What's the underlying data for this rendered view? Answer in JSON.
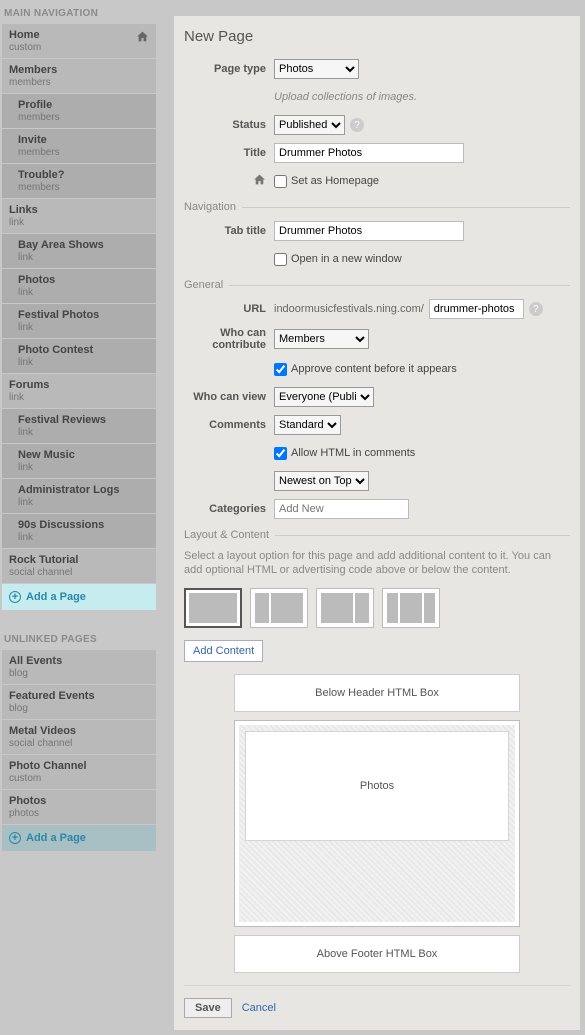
{
  "sidebar": {
    "main_heading": "MAIN NAVIGATION",
    "unlinked_heading": "UNLINKED PAGES",
    "add_page": "Add a Page",
    "main": [
      {
        "title": "Home",
        "sub": "custom",
        "home_icon": true
      },
      {
        "title": "Members",
        "sub": "members"
      },
      {
        "title": "Profile",
        "sub": "members",
        "indent": true
      },
      {
        "title": "Invite",
        "sub": "members",
        "indent": true
      },
      {
        "title": "Trouble?",
        "sub": "members",
        "indent": true
      },
      {
        "title": "Links",
        "sub": "link"
      },
      {
        "title": "Bay Area Shows",
        "sub": "link",
        "indent": true
      },
      {
        "title": "Photos",
        "sub": "link",
        "indent": true
      },
      {
        "title": "Festival Photos",
        "sub": "link",
        "indent": true
      },
      {
        "title": "Photo Contest",
        "sub": "link",
        "indent": true
      },
      {
        "title": "Forums",
        "sub": "link"
      },
      {
        "title": "Festival Reviews",
        "sub": "link",
        "indent": true
      },
      {
        "title": "New Music",
        "sub": "link",
        "indent": true
      },
      {
        "title": "Administrator Logs",
        "sub": "link",
        "indent": true
      },
      {
        "title": "90s Discussions",
        "sub": "link",
        "indent": true
      },
      {
        "title": "Rock Tutorial",
        "sub": "social channel"
      }
    ],
    "unlinked": [
      {
        "title": "All Events",
        "sub": "blog"
      },
      {
        "title": "Featured Events",
        "sub": "blog"
      },
      {
        "title": "Metal Videos",
        "sub": "social channel"
      },
      {
        "title": "Photo Channel",
        "sub": "custom"
      },
      {
        "title": "Photos",
        "sub": "photos"
      }
    ]
  },
  "page": {
    "heading": "New Page",
    "labels": {
      "page_type": "Page type",
      "status": "Status",
      "title": "Title",
      "set_homepage": "Set as Homepage",
      "tab_title": "Tab title",
      "open_new_window": "Open in a new window",
      "url": "URL",
      "who_contribute": "Who can contribute",
      "approve": "Approve content before it appears",
      "who_view": "Who can view",
      "comments": "Comments",
      "allow_html": "Allow HTML in comments",
      "categories": "Categories"
    },
    "sections": {
      "navigation": "Navigation",
      "general": "General",
      "layout": "Layout & Content"
    },
    "values": {
      "page_type": "Photos",
      "page_type_desc": "Upload collections of images.",
      "status": "Published",
      "title": "Drummer Photos",
      "tab_title": "Drummer Photos",
      "url_base": "indoormusicfestivals.ning.com/",
      "url_slug": "drummer-photos",
      "who_contribute": "Members",
      "who_view": "Everyone (Public)",
      "comments": "Standard",
      "comment_order": "Newest on Top",
      "categories_placeholder": "Add New",
      "approve_checked": true,
      "allow_html_checked": true
    },
    "layout": {
      "desc": "Select a layout option for this page and add additional content to it. You can add optional HTML or advertising code above or below the content.",
      "add_content": "Add Content",
      "below_header": "Below Header HTML Box",
      "photos": "Photos",
      "above_footer": "Above Footer HTML Box"
    },
    "actions": {
      "save": "Save",
      "cancel": "Cancel"
    }
  }
}
